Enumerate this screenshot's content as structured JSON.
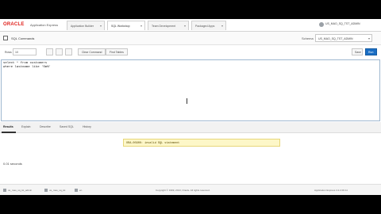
{
  "header": {
    "logo_text": "ORACLE",
    "product_name": "Application Express",
    "tabs": [
      {
        "label": "Application Builder"
      },
      {
        "label": "SQL Workshop"
      },
      {
        "label": "Team Development"
      },
      {
        "label": "Packaged Apps"
      }
    ],
    "user_label": "US_MAO_SQ_TST_ADMIN"
  },
  "breadcrumb": {
    "title": "SQL Commands",
    "schema_label": "Schema",
    "schema_value": "US_MAO_SQ_TST_ADMIN"
  },
  "toolbar": {
    "rows_label": "Rows",
    "rows_value": "10",
    "clear_label": "Clear Command",
    "find_label": "Find Tables",
    "save_label": "Save",
    "run_label": "Run"
  },
  "editor": {
    "code": "select * from customers\nwhere lastname like 'Sm%'"
  },
  "result_tabs": [
    {
      "label": "Results",
      "active": true
    },
    {
      "label": "Explain",
      "active": false
    },
    {
      "label": "Describe",
      "active": false
    },
    {
      "label": "Saved SQL",
      "active": false
    },
    {
      "label": "History",
      "active": false
    }
  ],
  "results": {
    "error_message": "ORA-00900: invalid SQL statement",
    "elapsed": "0.01 seconds"
  },
  "footer": {
    "items": [
      {
        "label": "us_mao_sq_tst_admin"
      },
      {
        "label": "us_mao_sq_tst"
      },
      {
        "label": "en"
      }
    ],
    "copyright": "Copyright © 1999, 2013, Oracle. All rights reserved.",
    "version": "Application Express 4.2.2.00.11"
  },
  "colors": {
    "brand_red": "#e0201b",
    "run_button": "#1a6ec4",
    "error_bg": "#fdf7c8"
  }
}
